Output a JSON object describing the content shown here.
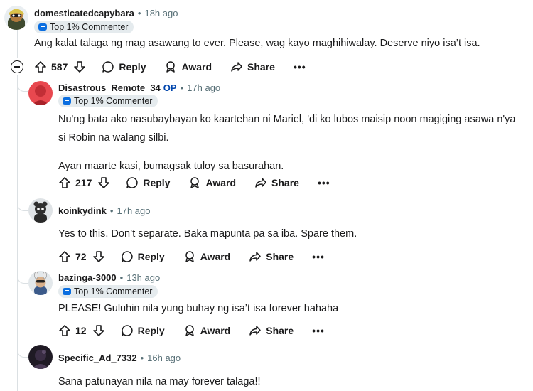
{
  "comments": [
    {
      "username": "domesticatedcapybara",
      "time": "18h ago",
      "flair": "Top 1% Commenter",
      "lines": [
        "Ang kalat talaga ng mag asawang to ever. Please, wag kayo maghihiwalay. Deserve niyo isa’t isa."
      ],
      "score": "587"
    },
    {
      "username": "Disastrous_Remote_34",
      "op": "OP",
      "time": "17h ago",
      "flair": "Top 1% Commenter",
      "lines": [
        "Nu'ng bata ako nasubaybayan ko kaartehan ni Mariel, 'di ko lubos maisip noon magiging asawa n'ya",
        "si Robin na walang silbi.",
        "",
        "Ayan maarte kasi, bumagsak tuloy sa basurahan."
      ],
      "score": "217"
    },
    {
      "username": "koinkydink",
      "time": "17h ago",
      "lines": [
        "Yes to this. Don’t separate. Baka mapunta pa sa iba. Spare them."
      ],
      "score": "72"
    },
    {
      "username": "bazinga-3000",
      "time": "13h ago",
      "flair": "Top 1% Commenter",
      "lines": [
        "PLEASE! Guluhin nila yung buhay ng isa’t isa forever hahaha"
      ],
      "score": "12"
    },
    {
      "username": "Specific_Ad_7332",
      "time": "16h ago",
      "lines": [
        "Sana patunayan nila na may forever talaga!!"
      ]
    }
  ],
  "actions": {
    "reply": "Reply",
    "award": "Award",
    "share": "Share",
    "more": "•••"
  },
  "separator": "•",
  "colors": {
    "op": "#0045ac",
    "meta": "#576f76",
    "flair_bg": "#e5ebee",
    "thread_line": "#dbe0e3"
  }
}
